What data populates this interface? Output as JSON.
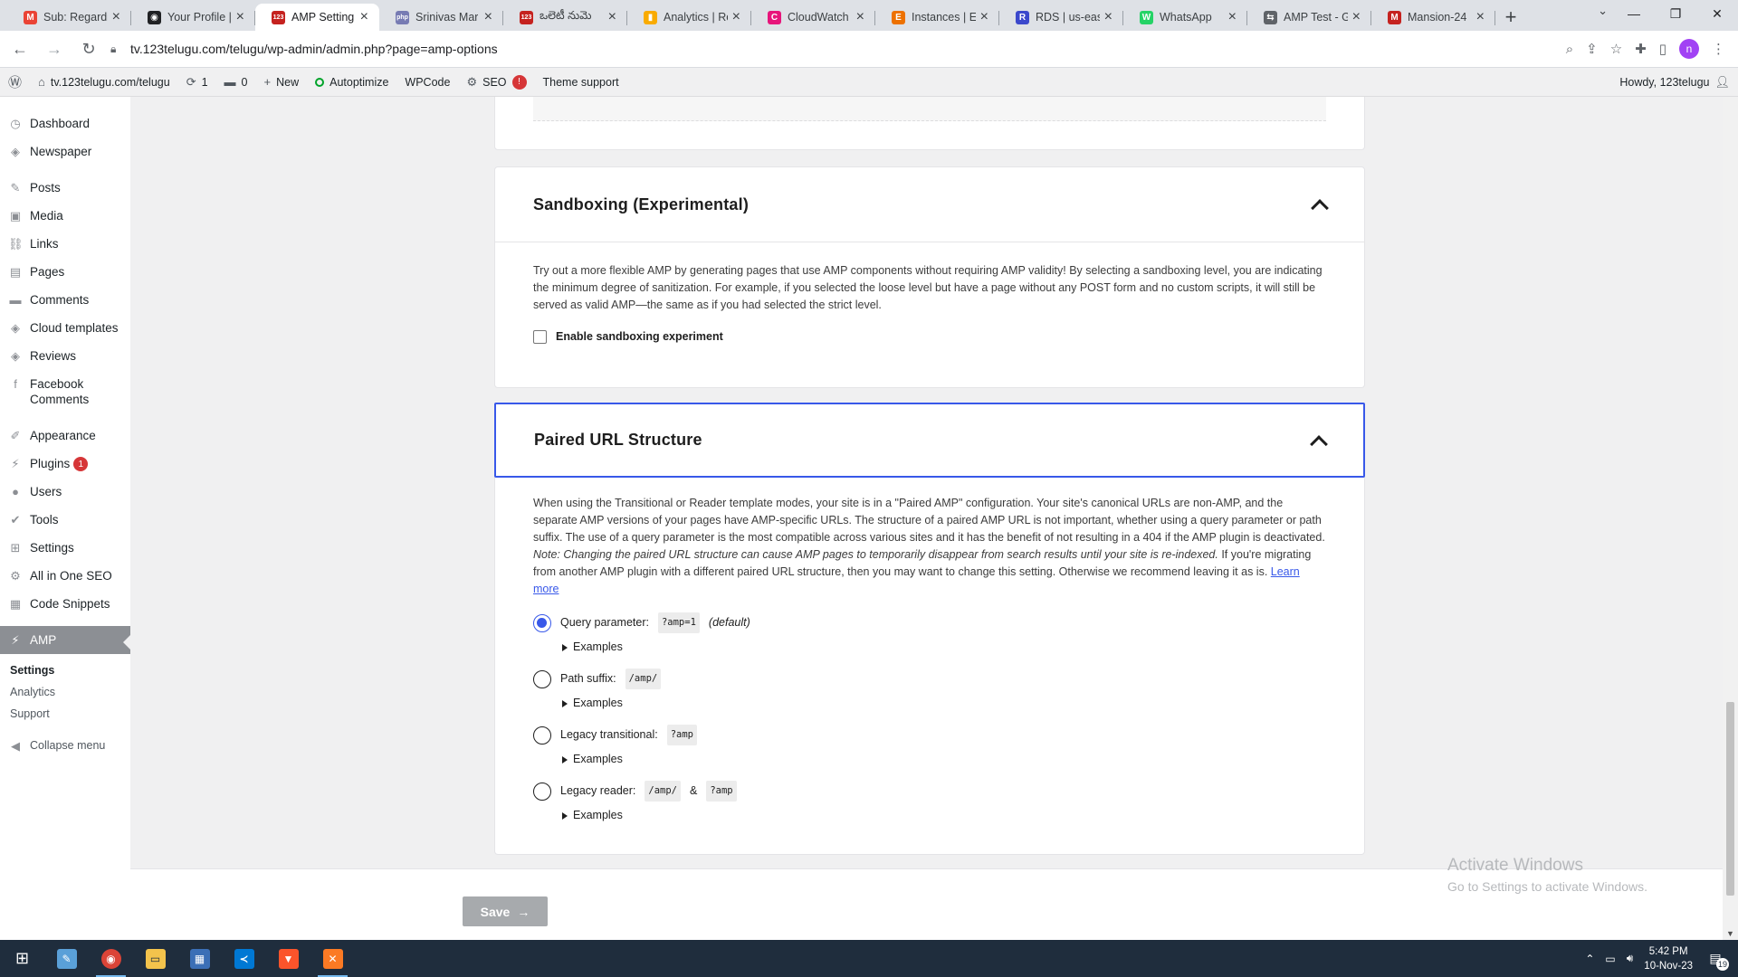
{
  "browser": {
    "tabs": [
      {
        "title": "Sub: Regardi",
        "favicon": "gmail-icon",
        "fav_color": "#ea4335",
        "fav_char": "M"
      },
      {
        "title": "Your Profile |",
        "favicon": "eye-icon",
        "fav_color": "#202124",
        "fav_char": "◉"
      },
      {
        "title": "AMP Setting",
        "favicon": "site-123-icon",
        "fav_color": "#c5221f",
        "fav_char": "123",
        "active": true
      },
      {
        "title": "Srinivas Mar",
        "favicon": "php-icon",
        "fav_color": "#777bb3",
        "fav_char": "php"
      },
      {
        "title": "ఒలెటీ నుమె",
        "favicon": "site-123-icon",
        "fav_color": "#c5221f",
        "fav_char": "123"
      },
      {
        "title": "Analytics | Re",
        "favicon": "analytics-icon",
        "fav_color": "#f9ab00",
        "fav_char": "▮"
      },
      {
        "title": "CloudWatch",
        "favicon": "cloudwatch-icon",
        "fav_color": "#e7157b",
        "fav_char": "C"
      },
      {
        "title": "Instances | E",
        "favicon": "ec2-icon",
        "fav_color": "#ed7100",
        "fav_char": "E"
      },
      {
        "title": "RDS | us-eas",
        "favicon": "rds-icon",
        "fav_color": "#3b48cc",
        "fav_char": "R"
      },
      {
        "title": "WhatsApp",
        "favicon": "whatsapp-icon",
        "fav_color": "#25d366",
        "fav_char": "W"
      },
      {
        "title": "AMP Test - G",
        "favicon": "amp-test-icon",
        "fav_color": "#5f6368",
        "fav_char": "⇆"
      },
      {
        "title": "Mansion-24",
        "favicon": "doc-icon",
        "fav_color": "#c5221f",
        "fav_char": "M"
      }
    ],
    "url": "tv.123telugu.com/telugu/wp-admin/admin.php?page=amp-options",
    "profile_initial": "n"
  },
  "adminbar": {
    "site": "tv.123telugu.com/telugu",
    "updates": "1",
    "comments": "0",
    "new": "New",
    "autoptimize": "Autoptimize",
    "wpcode": "WPCode",
    "seo": "SEO",
    "seo_badge": "!",
    "theme_support": "Theme support",
    "howdy": "Howdy, 123telugu"
  },
  "sidebar": {
    "items": [
      {
        "label": "Dashboard",
        "icon": "dashboard-icon",
        "glyph": "◷"
      },
      {
        "label": "Newspaper",
        "icon": "newspaper-icon",
        "glyph": "◈"
      },
      {
        "label": "Posts",
        "icon": "pin-icon",
        "glyph": "✎"
      },
      {
        "label": "Media",
        "icon": "media-icon",
        "glyph": "▣"
      },
      {
        "label": "Links",
        "icon": "link-icon",
        "glyph": "⛓"
      },
      {
        "label": "Pages",
        "icon": "pages-icon",
        "glyph": "▤"
      },
      {
        "label": "Comments",
        "icon": "comment-icon",
        "glyph": "▬"
      },
      {
        "label": "Cloud templates",
        "icon": "cloud-templates-icon",
        "glyph": "◈"
      },
      {
        "label": "Reviews",
        "icon": "reviews-icon",
        "glyph": "◈"
      },
      {
        "label": "Facebook Comments",
        "icon": "facebook-icon",
        "glyph": "f"
      },
      {
        "label": "Appearance",
        "icon": "brush-icon",
        "glyph": "✐"
      },
      {
        "label": "Plugins",
        "icon": "plugin-icon",
        "glyph": "⚡",
        "badge": "1"
      },
      {
        "label": "Users",
        "icon": "users-icon",
        "glyph": "●"
      },
      {
        "label": "Tools",
        "icon": "wrench-icon",
        "glyph": "✔"
      },
      {
        "label": "Settings",
        "icon": "settings-icon",
        "glyph": "⊞"
      },
      {
        "label": "All in One SEO",
        "icon": "aioseo-icon",
        "glyph": "⚙"
      },
      {
        "label": "Code Snippets",
        "icon": "code-icon",
        "glyph": "▦"
      }
    ],
    "current": {
      "label": "AMP",
      "icon": "amp-icon",
      "glyph": "⚡"
    },
    "submenu": [
      "Settings",
      "Analytics",
      "Support"
    ],
    "collapse": "Collapse menu"
  },
  "sandboxing": {
    "title": "Sandboxing (Experimental)",
    "description": "Try out a more flexible AMP by generating pages that use AMP components without requiring AMP validity! By selecting a sandboxing level, you are indicating the minimum degree of sanitization. For example, if you selected the loose level but have a page without any POST form and no custom scripts, it will still be served as valid AMP—the same as if you had selected the strict level.",
    "checkbox_label": "Enable sandboxing experiment",
    "checked": false
  },
  "paired": {
    "title": "Paired URL Structure",
    "description_1": "When using the Transitional or Reader template modes, your site is in a \"Paired AMP\" configuration. Your site's canonical URLs are non-AMP, and the separate AMP versions of your pages have AMP-specific URLs. The structure of a paired AMP URL is not important, whether using a query parameter or path suffix. The use of a query parameter is the most compatible across various sites and it has the benefit of not resulting in a 404 if the AMP plugin is deactivated. ",
    "description_note": "Note: Changing the paired URL structure can cause AMP pages to temporarily disappear from search results until your site is re-indexed.",
    "description_2": " If you're migrating from another AMP plugin with a different paired URL structure, then you may want to change this setting. Otherwise we recommend leaving it as is. ",
    "learn_more": "Learn more",
    "examples_label": "Examples",
    "options": {
      "query": {
        "label": "Query parameter:",
        "code": "?amp=1",
        "suffix": "(default)",
        "selected": true
      },
      "path": {
        "label": "Path suffix:",
        "code": "/amp/",
        "selected": false
      },
      "legacy_transitional": {
        "label": "Legacy transitional:",
        "code": "?amp",
        "selected": false
      },
      "legacy_reader": {
        "label": "Legacy reader:",
        "code": "/amp/",
        "joiner": "&",
        "code2": "?amp",
        "selected": false
      }
    }
  },
  "save_label": "Save",
  "watermark": {
    "line1": "Activate Windows",
    "line2": "Go to Settings to activate Windows."
  },
  "taskbar": {
    "time": "5:42 PM",
    "date": "10-Nov-23",
    "notifications": "19"
  }
}
